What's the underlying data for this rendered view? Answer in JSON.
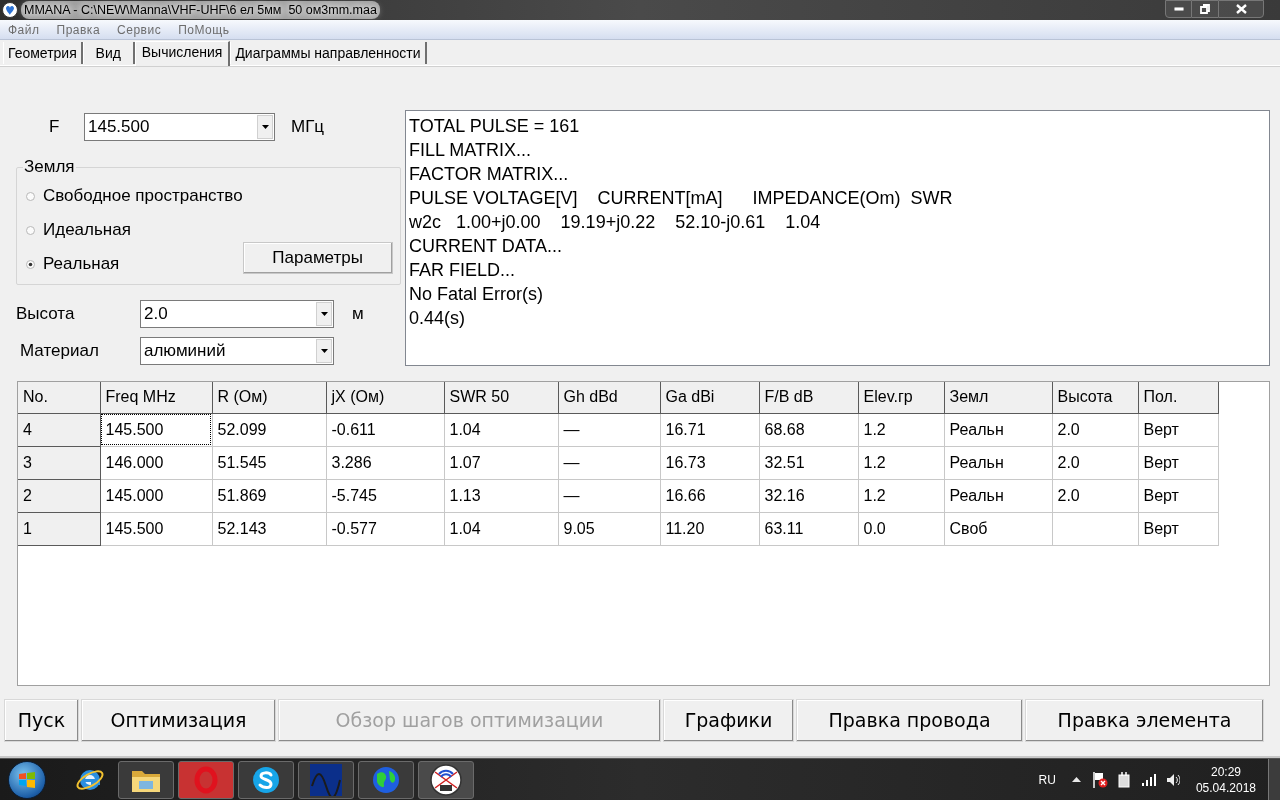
{
  "window": {
    "title": "MMANA - C:\\NEW\\Manna\\VHF-UHF\\6 ел 5мм  50 ом3mm.maa"
  },
  "menu": [
    "Файл",
    "Правка",
    "Сервис",
    "ПоМощь"
  ],
  "tabs": [
    {
      "label": "Геометрия",
      "selected": false
    },
    {
      "label": "Вид",
      "selected": false
    },
    {
      "label": "Вычисления",
      "selected": true
    },
    {
      "label": "Диаграммы направленности",
      "selected": false
    }
  ],
  "frequency": {
    "label": "F",
    "value": "145.500",
    "unit": "МГц"
  },
  "ground": {
    "title": "Земля",
    "options": [
      {
        "label": "Свободное пространство",
        "selected": false
      },
      {
        "label": "Идеальная",
        "selected": false
      },
      {
        "label": "Реальная",
        "selected": true
      }
    ],
    "button": "Параметры"
  },
  "height": {
    "label": "Высота",
    "value": "2.0",
    "unit": "м"
  },
  "material": {
    "label": "Материал",
    "value": "алюминий"
  },
  "output": [
    "TOTAL PULSE = 161",
    "FILL MATRIX...",
    "FACTOR MATRIX...",
    "PULSE VOLTAGE[V]    CURRENT[mA]      IMPEDANCE(Om)  SWR",
    "w2c   1.00+j0.00    19.19+j0.22    52.10-j0.61    1.04",
    "CURRENT DATA...",
    "FAR FIELD...",
    "No Fatal Error(s)",
    "0.44(s)"
  ],
  "table": {
    "columns": [
      "No.",
      "Freq MHz",
      "R (Ом)",
      "jX (Ом)",
      "SWR 50",
      "Gh dBd",
      "Ga dBi",
      "F/B dB",
      "Elev.гр",
      "Земл",
      "Высота",
      "Пол."
    ],
    "rows": [
      {
        "selected": true,
        "cells": [
          "4",
          "145.500",
          "52.099",
          "-0.611",
          "1.04",
          "—",
          "16.71",
          "68.68",
          "1.2",
          "Реальн",
          "2.0",
          "Верт"
        ]
      },
      {
        "selected": false,
        "cells": [
          "3",
          "146.000",
          "51.545",
          "3.286",
          "1.07",
          "—",
          "16.73",
          "32.51",
          "1.2",
          "Реальн",
          "2.0",
          "Верт"
        ]
      },
      {
        "selected": false,
        "cells": [
          "2",
          "145.000",
          "51.869",
          "-5.745",
          "1.13",
          "—",
          "16.66",
          "32.16",
          "1.2",
          "Реальн",
          "2.0",
          "Верт"
        ]
      },
      {
        "selected": false,
        "cells": [
          "1",
          "145.500",
          "52.143",
          "-0.577",
          "1.04",
          "9.05",
          "11.20",
          "63.11",
          "0.0",
          "Своб",
          null,
          "Верт"
        ]
      }
    ]
  },
  "buttons": [
    {
      "label": "Пуск",
      "disabled": false
    },
    {
      "label": "Оптимизация",
      "disabled": false
    },
    {
      "label": "Обзор шагов оптимизации",
      "disabled": true
    },
    {
      "label": "Графики",
      "disabled": false
    },
    {
      "label": "Правка провода",
      "disabled": false
    },
    {
      "label": "Правка элемента",
      "disabled": false
    }
  ],
  "taskbar": {
    "language": "RU",
    "time": "20:29",
    "date": "05.04.2018"
  }
}
